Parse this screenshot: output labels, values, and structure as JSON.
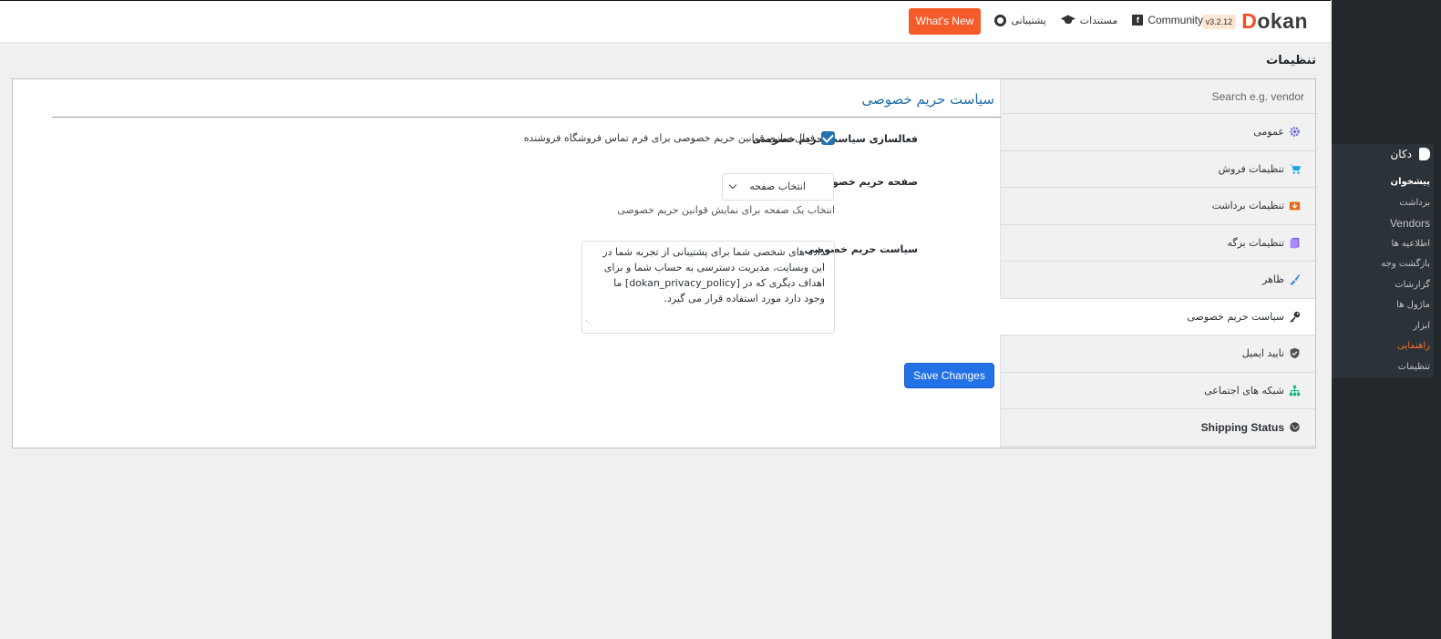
{
  "header": {
    "version": "v3.2.12",
    "brand_accent": "D",
    "brand_rest": "okan",
    "links": [
      {
        "label": "Community",
        "icon": "facebook-icon"
      },
      {
        "label": "مستندات",
        "icon": "graduation-cap-icon"
      },
      {
        "label": "پشتیبانی",
        "icon": "life-buoy-icon"
      }
    ],
    "whats_new": "What's New"
  },
  "page_title": "تنظیمات",
  "menu": {
    "search_placeholder": "Search e.g. vendor",
    "items": [
      {
        "label": "عمومی",
        "icon": "gear-icon",
        "color": "#6d6cdb"
      },
      {
        "label": "تنظیمات فروش",
        "icon": "cart-icon",
        "color": "#0ea5e9"
      },
      {
        "label": "تنظیمات برداشت",
        "icon": "withdraw-icon",
        "color": "#e86a1c"
      },
      {
        "label": "تنظیمات برگه",
        "icon": "pages-icon",
        "color": "#8b5cf6"
      },
      {
        "label": "ظاهر",
        "icon": "brush-icon",
        "color": "#3b82f6"
      },
      {
        "label": "سیاست حریم خصوصی",
        "icon": "key-icon",
        "color": "#333333"
      },
      {
        "label": "تایید ایمیل",
        "icon": "shield-icon",
        "color": "#555555"
      },
      {
        "label": "شبکه های اجتماعی",
        "icon": "network-icon",
        "color": "#10b981"
      },
      {
        "label": "Shipping Status",
        "icon": "globe-icon",
        "color": "#444444"
      }
    ],
    "active_index": 5
  },
  "section": {
    "title": "سیاست حریم خصوصی",
    "enable_label": "فعالسازی سیاست حریم خصوصی",
    "enable_text": "فعال سازی قوانین حریم خصوصی برای فرم تماس فروشگاه فروشنده",
    "enable_checked": true,
    "page_label": "صفحه حریم خصوصی",
    "page_select_value": "انتخاب صفحه",
    "page_hint": "انتخاب یک صفحه برای نمایش قوانین حریم خصوصی",
    "policy_label": "سیاست حریم خصوصی",
    "policy_text": "داده های شخصی شما برای پشتیبانی از تجربه شما در این وبسایت، مدیریت دسترسی به حساب شما و برای اهداف دیگری که در [dokan_privacy_policy] ما وجود دارد مورد استفاده قرار می گیرد.",
    "save_label": "Save Changes"
  },
  "wp_sidebar": {
    "head": "دکان",
    "items": [
      "پیشخوان",
      "برداشت",
      "Vendors",
      "اطلاعیه ها",
      "بازگشت وجه",
      "گزارشات",
      "ماژول ها",
      "ابزار",
      "راهنمایی",
      "تنظیمات"
    ],
    "accent": "#f56e28"
  }
}
